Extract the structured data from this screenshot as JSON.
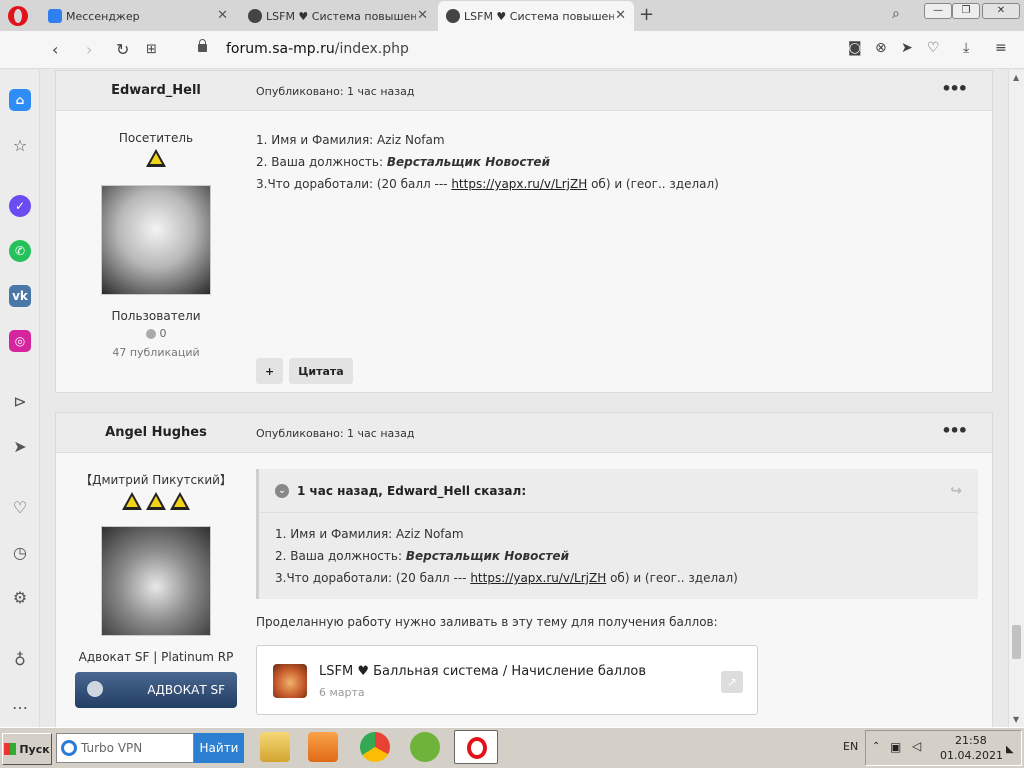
{
  "browser": {
    "tabs": [
      {
        "title": "Мессенджер",
        "active": false
      },
      {
        "title": "LSFM ♥ Система повышения",
        "active": false
      },
      {
        "title": "LSFM ♥ Система повышения",
        "active": true
      }
    ],
    "new_tab": "+",
    "url_domain": "forum.sa-mp.ru",
    "url_path": "/index.php",
    "window_controls": {
      "minimize": "—",
      "maximize": "❐",
      "close": "✕"
    }
  },
  "posts": [
    {
      "author": "Edward_Hell",
      "date": "Опубликовано: 1 час назад",
      "more": "•••",
      "author_title": "Посетитель",
      "group": "Пользователи",
      "reputation": "0",
      "publications": "47 публикаций",
      "lines": {
        "l1": "1. Имя и Фамилия: Aziz Nofam",
        "l2_prefix": "2. Ваша должность: ",
        "l2_bold": "Верстальщик Новостей",
        "l3_prefix": "3.Что доработали: (20 балл --- ",
        "l3_link": "https://yapx.ru/v/LrjZH",
        "l3_suffix": " об) и (геог.. зделал)"
      },
      "buttons": {
        "plus": "+",
        "quote": "Цитата"
      }
    },
    {
      "author": "Angel Hughes",
      "date": "Опубликовано: 1 час назад",
      "more": "•••",
      "author_title": "【Дмитрий Пикутский】",
      "group": "Адвокат SF | Platinum RP",
      "badge": "АДВОКАТ SF",
      "quote": {
        "header": "1 час назад, Edward_Hell сказал:",
        "l1": "1. Имя и Фамилия: Aziz Nofam",
        "l2_prefix": "2. Ваша должность: ",
        "l2_bold": "Верстальщик Новостей",
        "l3_prefix": "3.Что доработали: (20 балл --- ",
        "l3_link": "https://yapx.ru/v/LrjZH",
        "l3_suffix": " об) и (геог.. зделал)"
      },
      "text": "Проделанную работу нужно заливать в эту тему для получения баллов:",
      "embed": {
        "title": "LSFM ♥ Балльная система / Начисление баллов",
        "date": "6 марта"
      }
    }
  ],
  "taskbar": {
    "start": "Пуск",
    "search_placeholder": "Turbo VPN",
    "search_button": "Найти",
    "lang": "EN",
    "time": "21:58",
    "date": "01.04.2021"
  }
}
